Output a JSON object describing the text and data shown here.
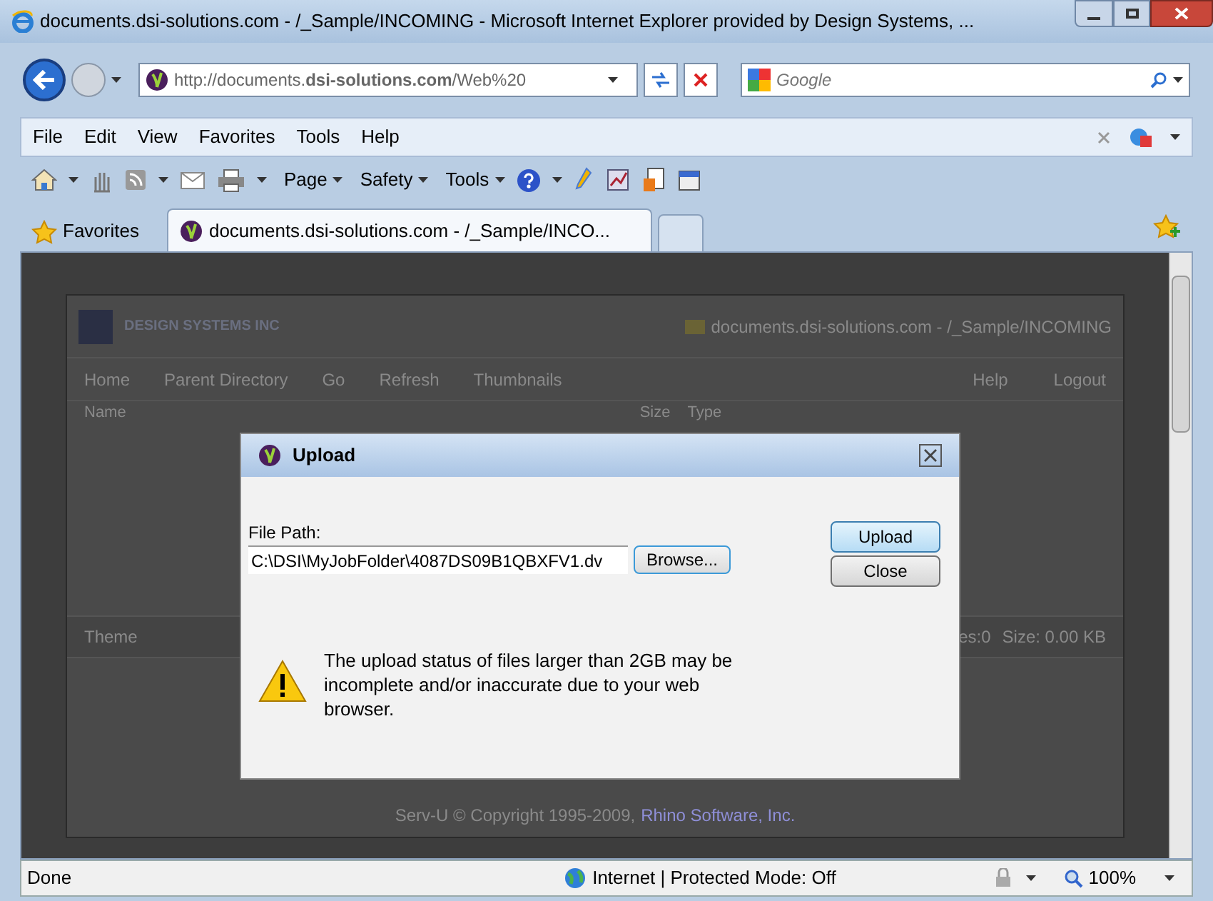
{
  "window": {
    "title": "documents.dsi-solutions.com - /_Sample/INCOMING - Microsoft Internet Explorer provided by Design Systems, ..."
  },
  "address": {
    "url": "http://documents.**dsi-solutions.com**/Web%20"
  },
  "search": {
    "placeholder": "Google"
  },
  "menu": [
    "File",
    "Edit",
    "View",
    "Favorites",
    "Tools",
    "Help"
  ],
  "command_bar": [
    "Page",
    "Safety",
    "Tools"
  ],
  "favorites": {
    "label": "Favorites"
  },
  "tabs": [
    {
      "label": "documents.dsi-solutions.com - /_Sample/INCO...",
      "selected": true
    }
  ],
  "page": {
    "logo": "DESIGN SYSTEMS INC",
    "location": "documents.dsi-solutions.com - /_Sample/INCOMING",
    "toolbar": [
      "Home",
      "Parent Directory",
      "Go",
      "Refresh",
      "Thumbnails"
    ],
    "toolbar_right": [
      "Help",
      "Logout"
    ],
    "columns": [
      "Name",
      "Size",
      "Type"
    ],
    "footer_left": "Theme",
    "footer_right": [
      "es:0",
      "Size: 0.00 KB"
    ],
    "copyright": "Serv-U © Copyright 1995-2009,",
    "copyright_link": "Rhino Software, Inc."
  },
  "dialog": {
    "title": "Upload",
    "field_label": "File Path:",
    "value": "C:\\DSI\\MyJobFolder\\4087DS09B1QBXFV1.dv",
    "browse": "Browse...",
    "buttons": [
      {
        "label": "Upload",
        "selected": true
      },
      {
        "label": "Close",
        "selected": false
      }
    ],
    "warning": "The upload status of files larger than 2GB may be incomplete and/or inaccurate due to your web browser."
  },
  "status_bar": {
    "text": "Done",
    "zone": "Internet | Protected Mode: Off",
    "zoom": "100%"
  }
}
